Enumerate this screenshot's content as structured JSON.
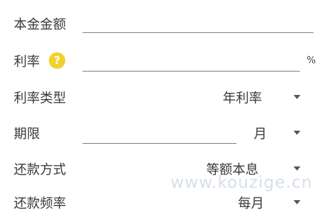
{
  "form": {
    "principal": {
      "label": "本金金额",
      "value": ""
    },
    "rate": {
      "label": "利率",
      "value": "",
      "unit": "%",
      "help_icon": "question-circle-icon"
    },
    "rate_type": {
      "label": "利率类型",
      "selected": "年利率"
    },
    "term": {
      "label": "期限",
      "value": "",
      "unit_selected": "月"
    },
    "repayment": {
      "label": "还款方式",
      "selected": "等额本息"
    },
    "frequency": {
      "label": "还款频率",
      "selected": "每月"
    }
  },
  "watermark": "www.kouzige.cn",
  "colors": {
    "help_icon_bg": "#f3d12c",
    "text": "#3a3a3a",
    "underline": "#7a7a7a"
  }
}
